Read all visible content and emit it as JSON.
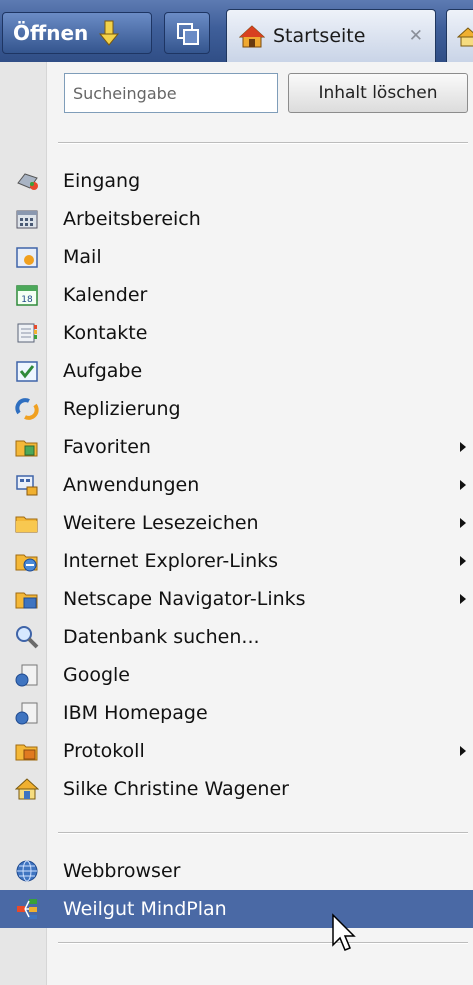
{
  "toolbar": {
    "open_label": "Öffnen",
    "tabs": [
      {
        "label": "Startseite",
        "close": "✕"
      },
      {
        "label": ""
      }
    ]
  },
  "menu": {
    "search": {
      "placeholder": "Sucheingabe",
      "clear_label": "Inhalt löschen"
    },
    "items": [
      {
        "label": "Eingang",
        "icon": "inbox-icon"
      },
      {
        "label": "Arbeitsbereich",
        "icon": "workspace-icon"
      },
      {
        "label": "Mail",
        "icon": "mail-icon"
      },
      {
        "label": "Kalender",
        "icon": "calendar-icon"
      },
      {
        "label": "Kontakte",
        "icon": "contacts-icon"
      },
      {
        "label": "Aufgabe",
        "icon": "task-icon"
      },
      {
        "label": "Replizierung",
        "icon": "replication-icon"
      },
      {
        "label": "Favoriten",
        "icon": "favorites-folder-icon",
        "submenu": true
      },
      {
        "label": "Anwendungen",
        "icon": "applications-icon",
        "submenu": true
      },
      {
        "label": "Weitere Lesezeichen",
        "icon": "folder-icon",
        "submenu": true
      },
      {
        "label": "Internet Explorer-Links",
        "icon": "ie-folder-icon",
        "submenu": true
      },
      {
        "label": "Netscape Navigator-Links",
        "icon": "netscape-folder-icon",
        "submenu": true
      },
      {
        "label": "Datenbank suchen...",
        "icon": "search-icon"
      },
      {
        "label": "Google",
        "icon": "database-icon"
      },
      {
        "label": "IBM Homepage",
        "icon": "database-icon"
      },
      {
        "label": "Protokoll",
        "icon": "history-folder-icon",
        "submenu": true
      },
      {
        "label": "Silke Christine Wagener",
        "icon": "user-home-icon"
      },
      {
        "label": "Webbrowser",
        "icon": "globe-icon"
      },
      {
        "label": "Weilgut MindPlan",
        "icon": "mindmap-icon",
        "selected": true
      }
    ]
  },
  "colors": {
    "accent": "#4a69a5",
    "toolbar": "#3f5f9a"
  }
}
